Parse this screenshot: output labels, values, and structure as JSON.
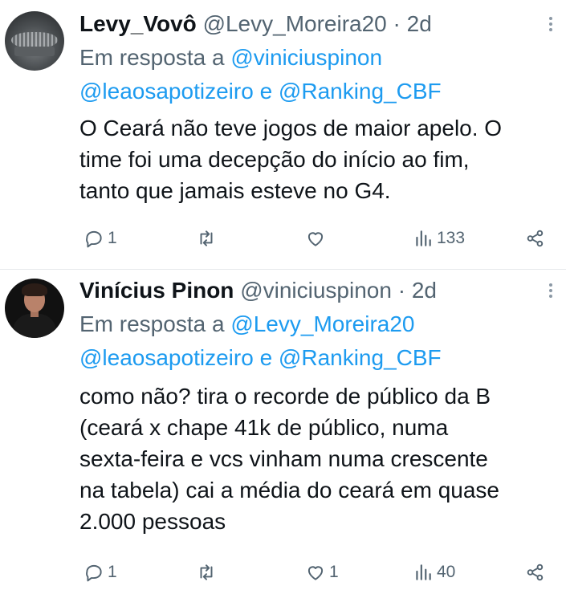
{
  "tweets": [
    {
      "name": "Levy_Vovô",
      "handle": "@Levy_Moreira20",
      "separator": "·",
      "time": "2d",
      "reply_prefix": "Em resposta a",
      "reply_mention_1": "@viniciuspinon",
      "reply_mention_2": "@leaosapotizeiro",
      "reply_and": "e",
      "reply_mention_3": "@Ranking_CBF",
      "body_lines": [
        "O Ceará não teve jogos de maior apelo. O",
        "time foi uma decepção  do início ao fim,",
        "tanto que jamais esteve no G4."
      ],
      "actions": {
        "reply_count": "1",
        "retweet_count": "",
        "like_count": "",
        "views_count": "133"
      },
      "icons": [
        "reply-icon",
        "retweet-icon",
        "like-icon",
        "views-icon",
        "share-icon",
        "more-icon"
      ]
    },
    {
      "name": "Vinícius Pinon",
      "handle": "@viniciuspinon",
      "separator": "·",
      "time": "2d",
      "reply_prefix": "Em resposta a",
      "reply_mention_1": "@Levy_Moreira20",
      "reply_mention_2": "@leaosapotizeiro",
      "reply_and": "e",
      "reply_mention_3": "@Ranking_CBF",
      "body_lines": [
        "como não? tira o recorde de público da B",
        "(ceará x chape 41k de público, numa",
        "sexta-feira e vcs vinham numa crescente",
        "na tabela) cai a média do ceará em quase",
        "2.000 pessoas"
      ],
      "actions": {
        "reply_count": "1",
        "retweet_count": "",
        "like_count": "1",
        "views_count": "40"
      },
      "icons": [
        "reply-icon",
        "retweet-icon",
        "like-icon",
        "views-icon",
        "share-icon",
        "more-icon"
      ]
    }
  ],
  "colors": {
    "text": "#0f1419",
    "secondary": "#536471",
    "link": "#1d9bf0",
    "divider": "#e6e9ec"
  }
}
